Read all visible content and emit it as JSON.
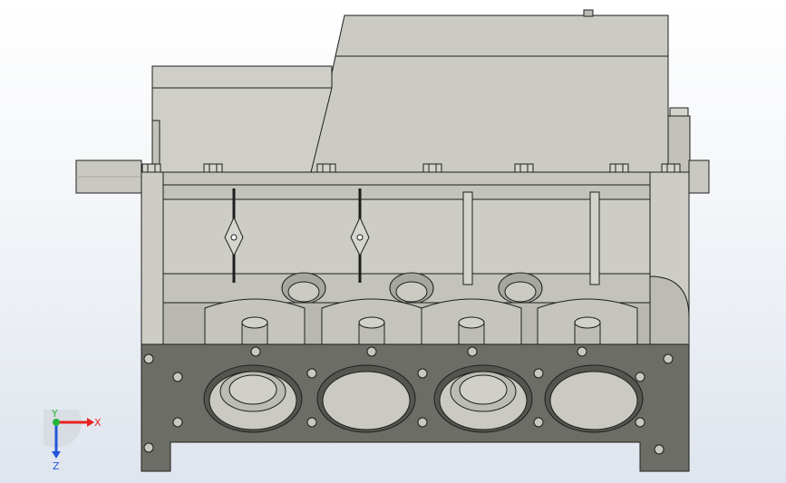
{
  "viewport": {
    "background_top": "#ffffff",
    "background_bottom": "#dfe5ee"
  },
  "model": {
    "name": "",
    "colors": {
      "body": "#c9c9c1",
      "body_light": "#d8d8d0",
      "body_dark": "#a9a9a1",
      "deck": "#6f6f69",
      "deck_dark": "#4a4a46",
      "edge": "#1e1e1e"
    },
    "cylinder_count": 4,
    "bolt_count": 7
  },
  "triad": {
    "x_label": "X",
    "y_label": "Y",
    "z_label": "Z",
    "colors": {
      "x": "#e8231f",
      "y": "#23b53a",
      "z": "#2356d8"
    }
  }
}
